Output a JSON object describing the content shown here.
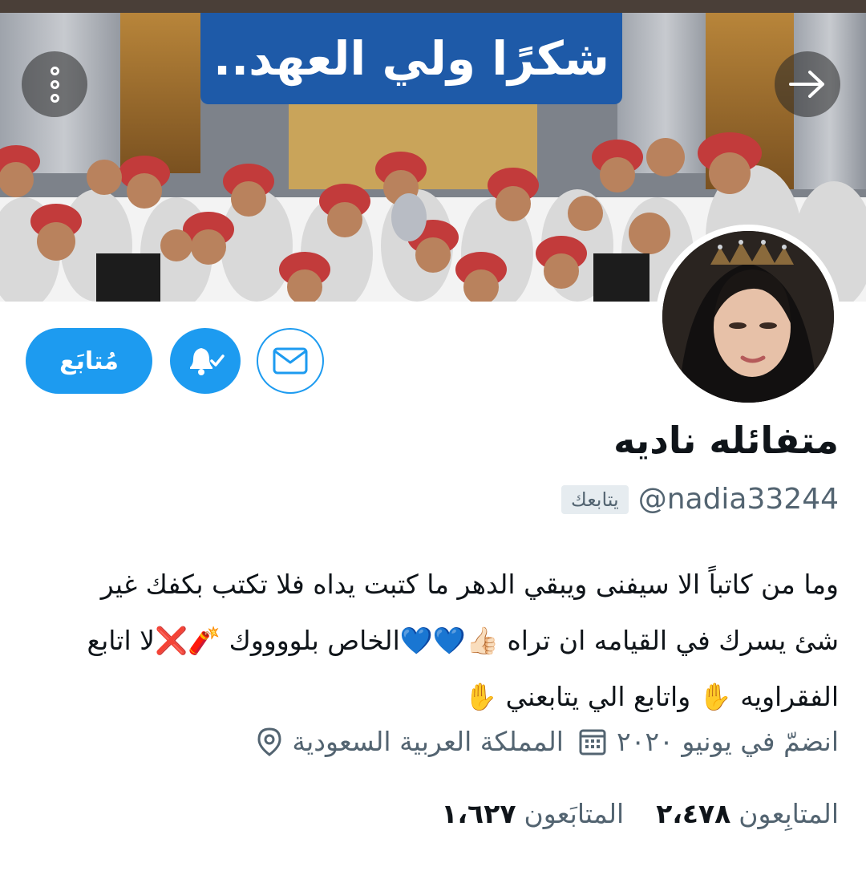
{
  "banner": {
    "title": "شكرًا ولي العهد..",
    "menu_icon": "more-vertical-icon",
    "forward_icon": "arrow-right-icon"
  },
  "actions": {
    "follow_label": "مُتابَع",
    "notification_icon": "bell-check-icon",
    "message_icon": "mail-icon"
  },
  "profile": {
    "display_name": "متفائله ناديه",
    "handle": "@nadia33244",
    "follows_you_badge": "يتابعك",
    "bio_lines": [
      "وما من كاتباً الا سيفنى ويبقي الدهر ما كتبت يداه فلا تكتب بكفك غير",
      "شئ يسرك في القيامه ان تراه 👍🏻💙💙الخاص بلووووك 🧨❌لا اتابع",
      "الفقراويه ✋ واتابع الي يتابعني ✋"
    ],
    "location": "المملكة العربية السعودية",
    "location_icon": "location-pin-icon",
    "joined": "انضمّ في يونيو ٢٠٢٠",
    "joined_icon": "calendar-icon"
  },
  "stats": {
    "following_count": "١،٦٢٧",
    "following_label": "المتابَعون",
    "followers_count": "٢،٤٧٨",
    "followers_label": "المتابِعون"
  },
  "colors": {
    "accent": "#1d9bf0",
    "secondary_text": "#536471",
    "banner_title_bg": "#1e5aa8"
  }
}
